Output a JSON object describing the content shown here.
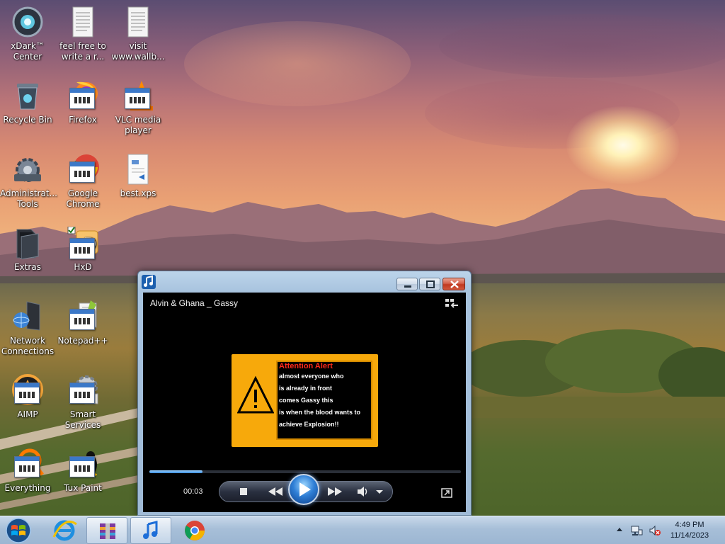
{
  "desktop": {
    "icons": [
      {
        "label": "xDark™ Center",
        "icon": "xdark-center-icon"
      },
      {
        "label": "feel free to write a r...",
        "icon": "text-document-icon"
      },
      {
        "label": "visit www.wallb...",
        "icon": "text-document-icon"
      },
      {
        "label": "Recycle Bin",
        "icon": "recycle-bin-icon"
      },
      {
        "label": "Firefox",
        "icon": "firefox-icon"
      },
      {
        "label": "VLC media player",
        "icon": "vlc-icon"
      },
      {
        "label": "Administrat... Tools",
        "icon": "administrative-tools-icon"
      },
      {
        "label": "Google Chrome",
        "icon": "chrome-icon"
      },
      {
        "label": "best.xps",
        "icon": "xps-document-icon"
      },
      {
        "label": "Extras",
        "icon": "folder-icon"
      },
      {
        "label": "HxD",
        "icon": "hxd-icon"
      },
      {
        "label": "Network Connections",
        "icon": "network-connections-icon"
      },
      {
        "label": "Notepad++",
        "icon": "notepad-plus-plus-icon"
      },
      {
        "label": "AIMP",
        "icon": "aimp-icon"
      },
      {
        "label": "Smart Services",
        "icon": "smart-services-icon"
      },
      {
        "label": "Everything",
        "icon": "everything-icon"
      },
      {
        "label": "Tux Paint",
        "icon": "tux-paint-icon"
      }
    ]
  },
  "player": {
    "title": "Alvin & Ghana _ Gassy",
    "alert": {
      "heading": "Attention Alert",
      "lines": [
        "almost everyone who",
        "is already in front",
        "comes Gassy this",
        "is when the blood wants to",
        "achieve Explosion!!"
      ]
    },
    "time": "00:03",
    "progress": 0.17,
    "accent": "#f7a90b"
  },
  "taskbar": {
    "time": "4:49 PM",
    "date": "11/14/2023"
  }
}
